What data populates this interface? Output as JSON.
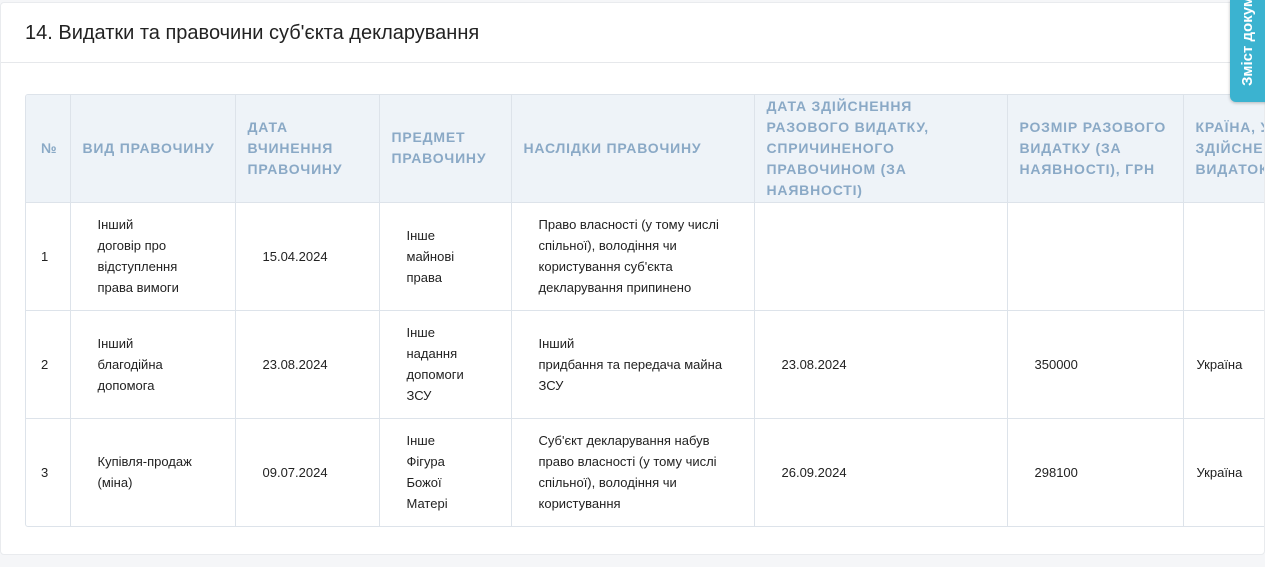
{
  "section": {
    "title": "14. Видатки та правочини суб'єкта декларування"
  },
  "side_tab": {
    "label": "Зміст документа"
  },
  "table": {
    "headers": [
      "№",
      "Вид правочину",
      "Дата вчинення правочину",
      "Предмет правочину",
      "Наслідки правочину",
      "Дата здійснення разового видатку, спричиненого правочином (за наявності)",
      "Розмір разового видатку (за наявності), грн",
      "Країна, у якій здійснено видаток"
    ],
    "rows": [
      {
        "num": "1",
        "kind": "Інший\nдоговір про\nвідступлення\nправа вимоги",
        "date": "15.04.2024",
        "subject": "Інше\nмайнові\nправа",
        "consequences": "Право власності (у тому числі\nспільної), володіння чи\nкористування суб'єкта\nдекларування припинено",
        "expense_date": "",
        "amount": "",
        "country": ""
      },
      {
        "num": "2",
        "kind": "Інший\nблагодійна\nдопомога",
        "date": "23.08.2024",
        "subject": "Інше\nнадання\nдопомоги\nЗСУ",
        "consequences": "Інший\nпридбання та передача майна\nЗСУ",
        "expense_date": "23.08.2024",
        "amount": "350000",
        "country": "Україна"
      },
      {
        "num": "3",
        "kind": "Купівля-продаж\n(міна)",
        "date": "09.07.2024",
        "subject": "Інше\nФігура\nБожої\nМатері",
        "consequences": "Суб'єкт декларування набув\nправо власності (у тому числі\nспільної), володіння чи\nкористування",
        "expense_date": "26.09.2024",
        "amount": "298100",
        "country": "Україна"
      }
    ]
  }
}
